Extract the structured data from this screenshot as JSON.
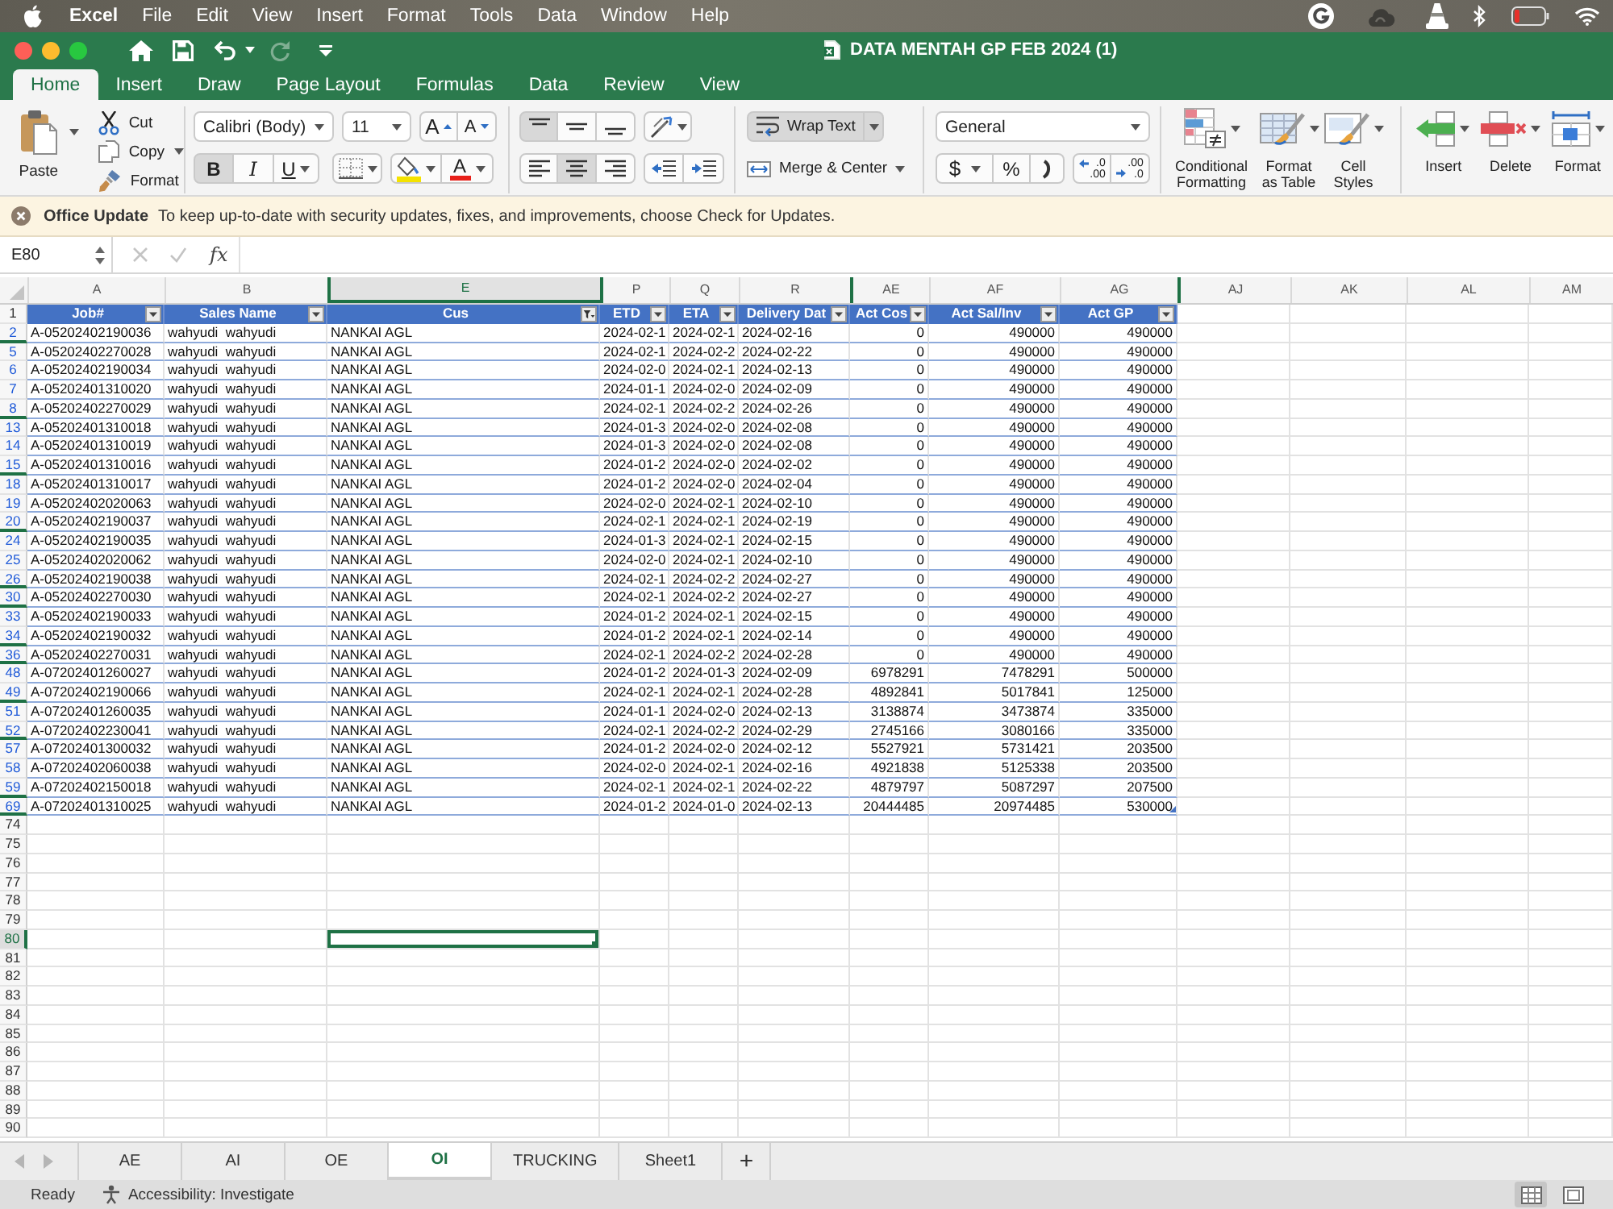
{
  "menu_bar": {
    "app": "Excel",
    "items": [
      "File",
      "Edit",
      "View",
      "Insert",
      "Format",
      "Tools",
      "Data",
      "Window",
      "Help"
    ]
  },
  "window": {
    "title": "DATA MENTAH GP FEB 2024 (1)"
  },
  "quick_access": [
    {
      "kind": "home",
      "disabled": false
    },
    {
      "kind": "save",
      "disabled": false
    },
    {
      "kind": "undo",
      "disabled": false
    },
    {
      "kind": "redo",
      "disabled": true
    },
    {
      "kind": "customize",
      "disabled": false
    }
  ],
  "ribbon_tabs": [
    {
      "label": "Home",
      "selected": true
    },
    {
      "label": "Insert",
      "selected": false
    },
    {
      "label": "Draw",
      "selected": false
    },
    {
      "label": "Page Layout",
      "selected": false
    },
    {
      "label": "Formulas",
      "selected": false
    },
    {
      "label": "Data",
      "selected": false
    },
    {
      "label": "Review",
      "selected": false
    },
    {
      "label": "View",
      "selected": false
    }
  ],
  "ribbon": {
    "clipboard": {
      "paste": "Paste",
      "cut": "Cut",
      "copy": "Copy",
      "format_painter": "Format"
    },
    "font": {
      "name": "Calibri (Body)",
      "size": "11",
      "grow": "A",
      "shrink": "A",
      "color_label": "A"
    },
    "styles": [
      {
        "kind": "bold",
        "label": "B",
        "selected": true
      },
      {
        "kind": "italic",
        "label": "I",
        "selected": false
      },
      {
        "kind": "underline",
        "label": "U",
        "selected": false
      }
    ],
    "vertical_align": [
      {
        "kind": "top",
        "selected": true
      },
      {
        "kind": "middle",
        "selected": false
      },
      {
        "kind": "bottom",
        "selected": false
      }
    ],
    "horizontal_align": [
      {
        "kind": "left",
        "selected": false
      },
      {
        "kind": "center",
        "selected": true
      },
      {
        "kind": "right",
        "selected": false
      }
    ],
    "wrap_text": {
      "label": "Wrap Text",
      "selected": true
    },
    "merge": {
      "label": "Merge & Center"
    },
    "number_format": "General",
    "number_buttons": [
      {
        "kind": "currency",
        "label": "$"
      },
      {
        "kind": "percent",
        "label": "%"
      }
    ],
    "decimal_buttons": [
      {
        "kind": "increase",
        "top": ".0",
        "bottom": ".00"
      },
      {
        "kind": "decrease",
        "top": ".00",
        "bottom": ".0"
      }
    ],
    "style_tools": [
      {
        "kind": "conditional",
        "label": "Conditional Formatting"
      },
      {
        "kind": "table",
        "label": "Format as Table"
      },
      {
        "kind": "cell_styles",
        "label": "Cell Styles"
      }
    ],
    "cell_tools": [
      {
        "kind": "insert",
        "label": "Insert"
      },
      {
        "kind": "delete",
        "label": "Delete"
      },
      {
        "kind": "format",
        "label": "Format"
      }
    ]
  },
  "notice": {
    "title": "Office Update",
    "message": "To keep up-to-date with security updates, fixes, and improvements, choose Check for Updates."
  },
  "formula_bar": {
    "name_box": "E80",
    "buttons": [
      {
        "kind": "cancel",
        "disabled": true
      },
      {
        "kind": "enter",
        "disabled": true
      }
    ],
    "function_label": "fx"
  },
  "sheet": {
    "columns": [
      {
        "label": "A",
        "selected": false,
        "hidden_before": false
      },
      {
        "label": "B",
        "selected": false,
        "hidden_before": false
      },
      {
        "label": "E",
        "selected": true,
        "hidden_before": true
      },
      {
        "label": "P",
        "selected": false,
        "hidden_before": true
      },
      {
        "label": "Q",
        "selected": false,
        "hidden_before": false
      },
      {
        "label": "R",
        "selected": false,
        "hidden_before": false
      },
      {
        "label": "AE",
        "selected": false,
        "hidden_before": true
      },
      {
        "label": "AF",
        "selected": false,
        "hidden_before": false
      },
      {
        "label": "AG",
        "selected": false,
        "hidden_before": false
      },
      {
        "label": "AJ",
        "selected": false,
        "hidden_before": true
      },
      {
        "label": "AK",
        "selected": false,
        "hidden_before": false
      },
      {
        "label": "AL",
        "selected": false,
        "hidden_before": false
      },
      {
        "label": "AM",
        "selected": false,
        "hidden_before": false
      }
    ],
    "header_row": {
      "number": "1",
      "cells": [
        {
          "label": "Job#",
          "filtered": false
        },
        {
          "label": "Sales Name",
          "filtered": false
        },
        {
          "label": "Cus",
          "filtered": true
        },
        {
          "label": "ETD",
          "filtered": false
        },
        {
          "label": "ETA",
          "filtered": false
        },
        {
          "label": "Delivery Dat",
          "filtered": false
        },
        {
          "label": "Act Cos",
          "filtered": false
        },
        {
          "label": "Act Sal/Inv",
          "filtered": false
        },
        {
          "label": "Act GP",
          "filtered": false
        }
      ]
    },
    "rows": [
      {
        "number": "2",
        "filtered": true,
        "selected": false,
        "hidden_below": true,
        "cells": [
          "A-05202402190036",
          "wahyudi  wahyudi",
          "NANKAI AGL",
          "2024-02-1",
          "2024-02-1",
          "2024-02-16",
          "0",
          "490000",
          "490000"
        ]
      },
      {
        "number": "5",
        "filtered": true,
        "selected": false,
        "hidden_below": false,
        "cells": [
          "A-05202402270028",
          "wahyudi  wahyudi",
          "NANKAI AGL",
          "2024-02-1",
          "2024-02-2",
          "2024-02-22",
          "0",
          "490000",
          "490000"
        ]
      },
      {
        "number": "6",
        "filtered": true,
        "selected": false,
        "hidden_below": false,
        "cells": [
          "A-05202402190034",
          "wahyudi  wahyudi",
          "NANKAI AGL",
          "2024-02-0",
          "2024-02-1",
          "2024-02-13",
          "0",
          "490000",
          "490000"
        ]
      },
      {
        "number": "7",
        "filtered": true,
        "selected": false,
        "hidden_below": false,
        "cells": [
          "A-05202401310020",
          "wahyudi  wahyudi",
          "NANKAI AGL",
          "2024-01-1",
          "2024-02-0",
          "2024-02-09",
          "0",
          "490000",
          "490000"
        ]
      },
      {
        "number": "8",
        "filtered": true,
        "selected": false,
        "hidden_below": true,
        "cells": [
          "A-05202402270029",
          "wahyudi  wahyudi",
          "NANKAI AGL",
          "2024-02-1",
          "2024-02-2",
          "2024-02-26",
          "0",
          "490000",
          "490000"
        ]
      },
      {
        "number": "13",
        "filtered": true,
        "selected": false,
        "hidden_below": false,
        "cells": [
          "A-05202401310018",
          "wahyudi  wahyudi",
          "NANKAI AGL",
          "2024-01-3",
          "2024-02-0",
          "2024-02-08",
          "0",
          "490000",
          "490000"
        ]
      },
      {
        "number": "14",
        "filtered": true,
        "selected": false,
        "hidden_below": false,
        "cells": [
          "A-05202401310019",
          "wahyudi  wahyudi",
          "NANKAI AGL",
          "2024-01-3",
          "2024-02-0",
          "2024-02-08",
          "0",
          "490000",
          "490000"
        ]
      },
      {
        "number": "15",
        "filtered": true,
        "selected": false,
        "hidden_below": true,
        "cells": [
          "A-05202401310016",
          "wahyudi  wahyudi",
          "NANKAI AGL",
          "2024-01-2",
          "2024-02-0",
          "2024-02-02",
          "0",
          "490000",
          "490000"
        ]
      },
      {
        "number": "18",
        "filtered": true,
        "selected": false,
        "hidden_below": false,
        "cells": [
          "A-05202401310017",
          "wahyudi  wahyudi",
          "NANKAI AGL",
          "2024-01-2",
          "2024-02-0",
          "2024-02-04",
          "0",
          "490000",
          "490000"
        ]
      },
      {
        "number": "19",
        "filtered": true,
        "selected": false,
        "hidden_below": false,
        "cells": [
          "A-05202402020063",
          "wahyudi  wahyudi",
          "NANKAI AGL",
          "2024-02-0",
          "2024-02-1",
          "2024-02-10",
          "0",
          "490000",
          "490000"
        ]
      },
      {
        "number": "20",
        "filtered": true,
        "selected": false,
        "hidden_below": true,
        "cells": [
          "A-05202402190037",
          "wahyudi  wahyudi",
          "NANKAI AGL",
          "2024-02-1",
          "2024-02-1",
          "2024-02-19",
          "0",
          "490000",
          "490000"
        ]
      },
      {
        "number": "24",
        "filtered": true,
        "selected": false,
        "hidden_below": false,
        "cells": [
          "A-05202402190035",
          "wahyudi  wahyudi",
          "NANKAI AGL",
          "2024-01-3",
          "2024-02-1",
          "2024-02-15",
          "0",
          "490000",
          "490000"
        ]
      },
      {
        "number": "25",
        "filtered": true,
        "selected": false,
        "hidden_below": false,
        "cells": [
          "A-05202402020062",
          "wahyudi  wahyudi",
          "NANKAI AGL",
          "2024-02-0",
          "2024-02-1",
          "2024-02-10",
          "0",
          "490000",
          "490000"
        ]
      },
      {
        "number": "26",
        "filtered": true,
        "selected": false,
        "hidden_below": true,
        "cells": [
          "A-05202402190038",
          "wahyudi  wahyudi",
          "NANKAI AGL",
          "2024-02-1",
          "2024-02-2",
          "2024-02-27",
          "0",
          "490000",
          "490000"
        ]
      },
      {
        "number": "30",
        "filtered": true,
        "selected": false,
        "hidden_below": true,
        "cells": [
          "A-05202402270030",
          "wahyudi  wahyudi",
          "NANKAI AGL",
          "2024-02-1",
          "2024-02-2",
          "2024-02-27",
          "0",
          "490000",
          "490000"
        ]
      },
      {
        "number": "33",
        "filtered": true,
        "selected": false,
        "hidden_below": false,
        "cells": [
          "A-05202402190033",
          "wahyudi  wahyudi",
          "NANKAI AGL",
          "2024-01-2",
          "2024-02-1",
          "2024-02-15",
          "0",
          "490000",
          "490000"
        ]
      },
      {
        "number": "34",
        "filtered": true,
        "selected": false,
        "hidden_below": true,
        "cells": [
          "A-05202402190032",
          "wahyudi  wahyudi",
          "NANKAI AGL",
          "2024-01-2",
          "2024-02-1",
          "2024-02-14",
          "0",
          "490000",
          "490000"
        ]
      },
      {
        "number": "36",
        "filtered": true,
        "selected": false,
        "hidden_below": true,
        "cells": [
          "A-05202402270031",
          "wahyudi  wahyudi",
          "NANKAI AGL",
          "2024-02-1",
          "2024-02-2",
          "2024-02-28",
          "0",
          "490000",
          "490000"
        ]
      },
      {
        "number": "48",
        "filtered": true,
        "selected": false,
        "hidden_below": false,
        "cells": [
          "A-07202401260027",
          "wahyudi  wahyudi",
          "NANKAI AGL",
          "2024-01-2",
          "2024-01-3",
          "2024-02-09",
          "6978291",
          "7478291",
          "500000"
        ]
      },
      {
        "number": "49",
        "filtered": true,
        "selected": false,
        "hidden_below": true,
        "cells": [
          "A-07202402190066",
          "wahyudi  wahyudi",
          "NANKAI AGL",
          "2024-02-1",
          "2024-02-1",
          "2024-02-28",
          "4892841",
          "5017841",
          "125000"
        ]
      },
      {
        "number": "51",
        "filtered": true,
        "selected": false,
        "hidden_below": false,
        "cells": [
          "A-07202401260035",
          "wahyudi  wahyudi",
          "NANKAI AGL",
          "2024-01-1",
          "2024-02-0",
          "2024-02-13",
          "3138874",
          "3473874",
          "335000"
        ]
      },
      {
        "number": "52",
        "filtered": true,
        "selected": false,
        "hidden_below": true,
        "cells": [
          "A-07202402230041",
          "wahyudi  wahyudi",
          "NANKAI AGL",
          "2024-02-1",
          "2024-02-2",
          "2024-02-29",
          "2745166",
          "3080166",
          "335000"
        ]
      },
      {
        "number": "57",
        "filtered": true,
        "selected": false,
        "hidden_below": false,
        "cells": [
          "A-07202401300032",
          "wahyudi  wahyudi",
          "NANKAI AGL",
          "2024-01-2",
          "2024-02-0",
          "2024-02-12",
          "5527921",
          "5731421",
          "203500"
        ]
      },
      {
        "number": "58",
        "filtered": true,
        "selected": false,
        "hidden_below": false,
        "cells": [
          "A-07202402060038",
          "wahyudi  wahyudi",
          "NANKAI AGL",
          "2024-02-0",
          "2024-02-1",
          "2024-02-16",
          "4921838",
          "5125338",
          "203500"
        ]
      },
      {
        "number": "59",
        "filtered": true,
        "selected": false,
        "hidden_below": true,
        "cells": [
          "A-07202402150018",
          "wahyudi  wahyudi",
          "NANKAI AGL",
          "2024-02-1",
          "2024-02-1",
          "2024-02-22",
          "4879797",
          "5087297",
          "207500"
        ]
      },
      {
        "number": "69",
        "filtered": true,
        "selected": false,
        "hidden_below": true,
        "cells": [
          "A-07202401310025",
          "wahyudi  wahyudi",
          "NANKAI AGL",
          "2024-01-2",
          "2024-01-0",
          "2024-02-13",
          "20444485",
          "20974485",
          "530000"
        ]
      },
      {
        "number": "74",
        "filtered": false,
        "selected": false,
        "hidden_below": false
      },
      {
        "number": "75",
        "filtered": false,
        "selected": false,
        "hidden_below": false
      },
      {
        "number": "76",
        "filtered": false,
        "selected": false,
        "hidden_below": false
      },
      {
        "number": "77",
        "filtered": false,
        "selected": false,
        "hidden_below": false
      },
      {
        "number": "78",
        "filtered": false,
        "selected": false,
        "hidden_below": false
      },
      {
        "number": "79",
        "filtered": false,
        "selected": false,
        "hidden_below": false
      },
      {
        "number": "80",
        "filtered": false,
        "selected": true,
        "hidden_below": false
      },
      {
        "number": "81",
        "filtered": false,
        "selected": false,
        "hidden_below": false
      },
      {
        "number": "82",
        "filtered": false,
        "selected": false,
        "hidden_below": false
      },
      {
        "number": "83",
        "filtered": false,
        "selected": false,
        "hidden_below": false
      },
      {
        "number": "84",
        "filtered": false,
        "selected": false,
        "hidden_below": false
      },
      {
        "number": "85",
        "filtered": false,
        "selected": false,
        "hidden_below": false
      },
      {
        "number": "86",
        "filtered": false,
        "selected": false,
        "hidden_below": false
      },
      {
        "number": "87",
        "filtered": false,
        "selected": false,
        "hidden_below": false
      },
      {
        "number": "88",
        "filtered": false,
        "selected": false,
        "hidden_below": false
      },
      {
        "number": "89",
        "filtered": false,
        "selected": false,
        "hidden_below": false
      },
      {
        "number": "90",
        "filtered": false,
        "selected": false,
        "hidden_below": false
      }
    ]
  },
  "sheet_tabs": {
    "tabs": [
      {
        "label": "AE",
        "selected": false
      },
      {
        "label": "AI",
        "selected": false
      },
      {
        "label": "OE",
        "selected": false
      },
      {
        "label": "OI",
        "selected": true
      },
      {
        "label": "TRUCKING",
        "selected": false
      },
      {
        "label": "Sheet1",
        "selected": false
      }
    ],
    "add_label": "+"
  },
  "status_bar": {
    "status": "Ready",
    "accessibility": "Accessibility: Investigate",
    "views": [
      {
        "kind": "normal",
        "selected": true
      },
      {
        "kind": "page_layout",
        "selected": false
      }
    ]
  }
}
